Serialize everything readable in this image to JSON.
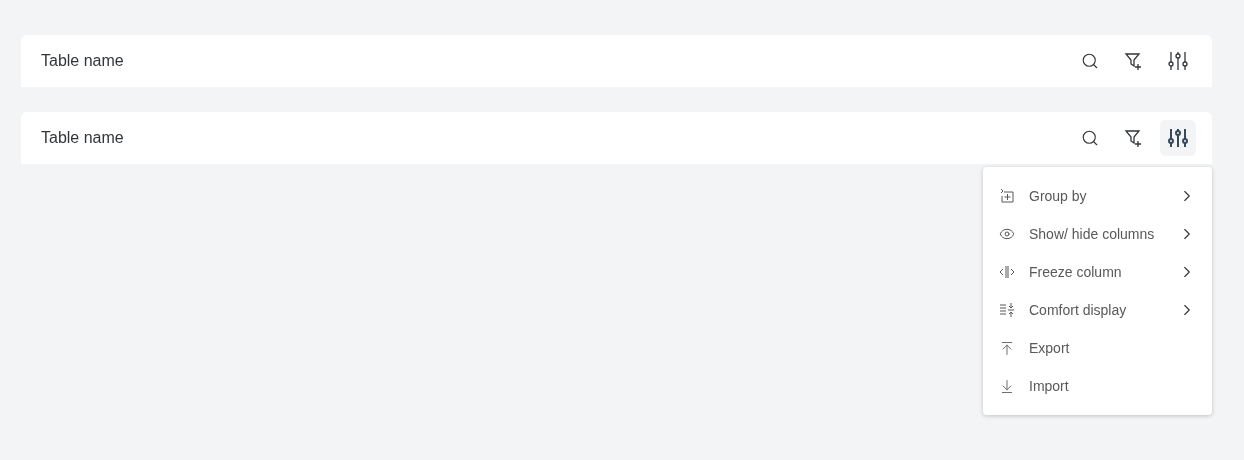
{
  "toolbars": [
    {
      "title": "Table name",
      "settings_open": false
    },
    {
      "title": "Table name",
      "settings_open": true
    }
  ],
  "settings_menu": {
    "items": [
      {
        "label": "Group by",
        "has_submenu": true
      },
      {
        "label": "Show/ hide columns",
        "has_submenu": true
      },
      {
        "label": "Freeze column",
        "has_submenu": true
      },
      {
        "label": "Comfort display",
        "has_submenu": true
      },
      {
        "label": "Export",
        "has_submenu": false
      },
      {
        "label": "Import",
        "has_submenu": false
      }
    ]
  }
}
